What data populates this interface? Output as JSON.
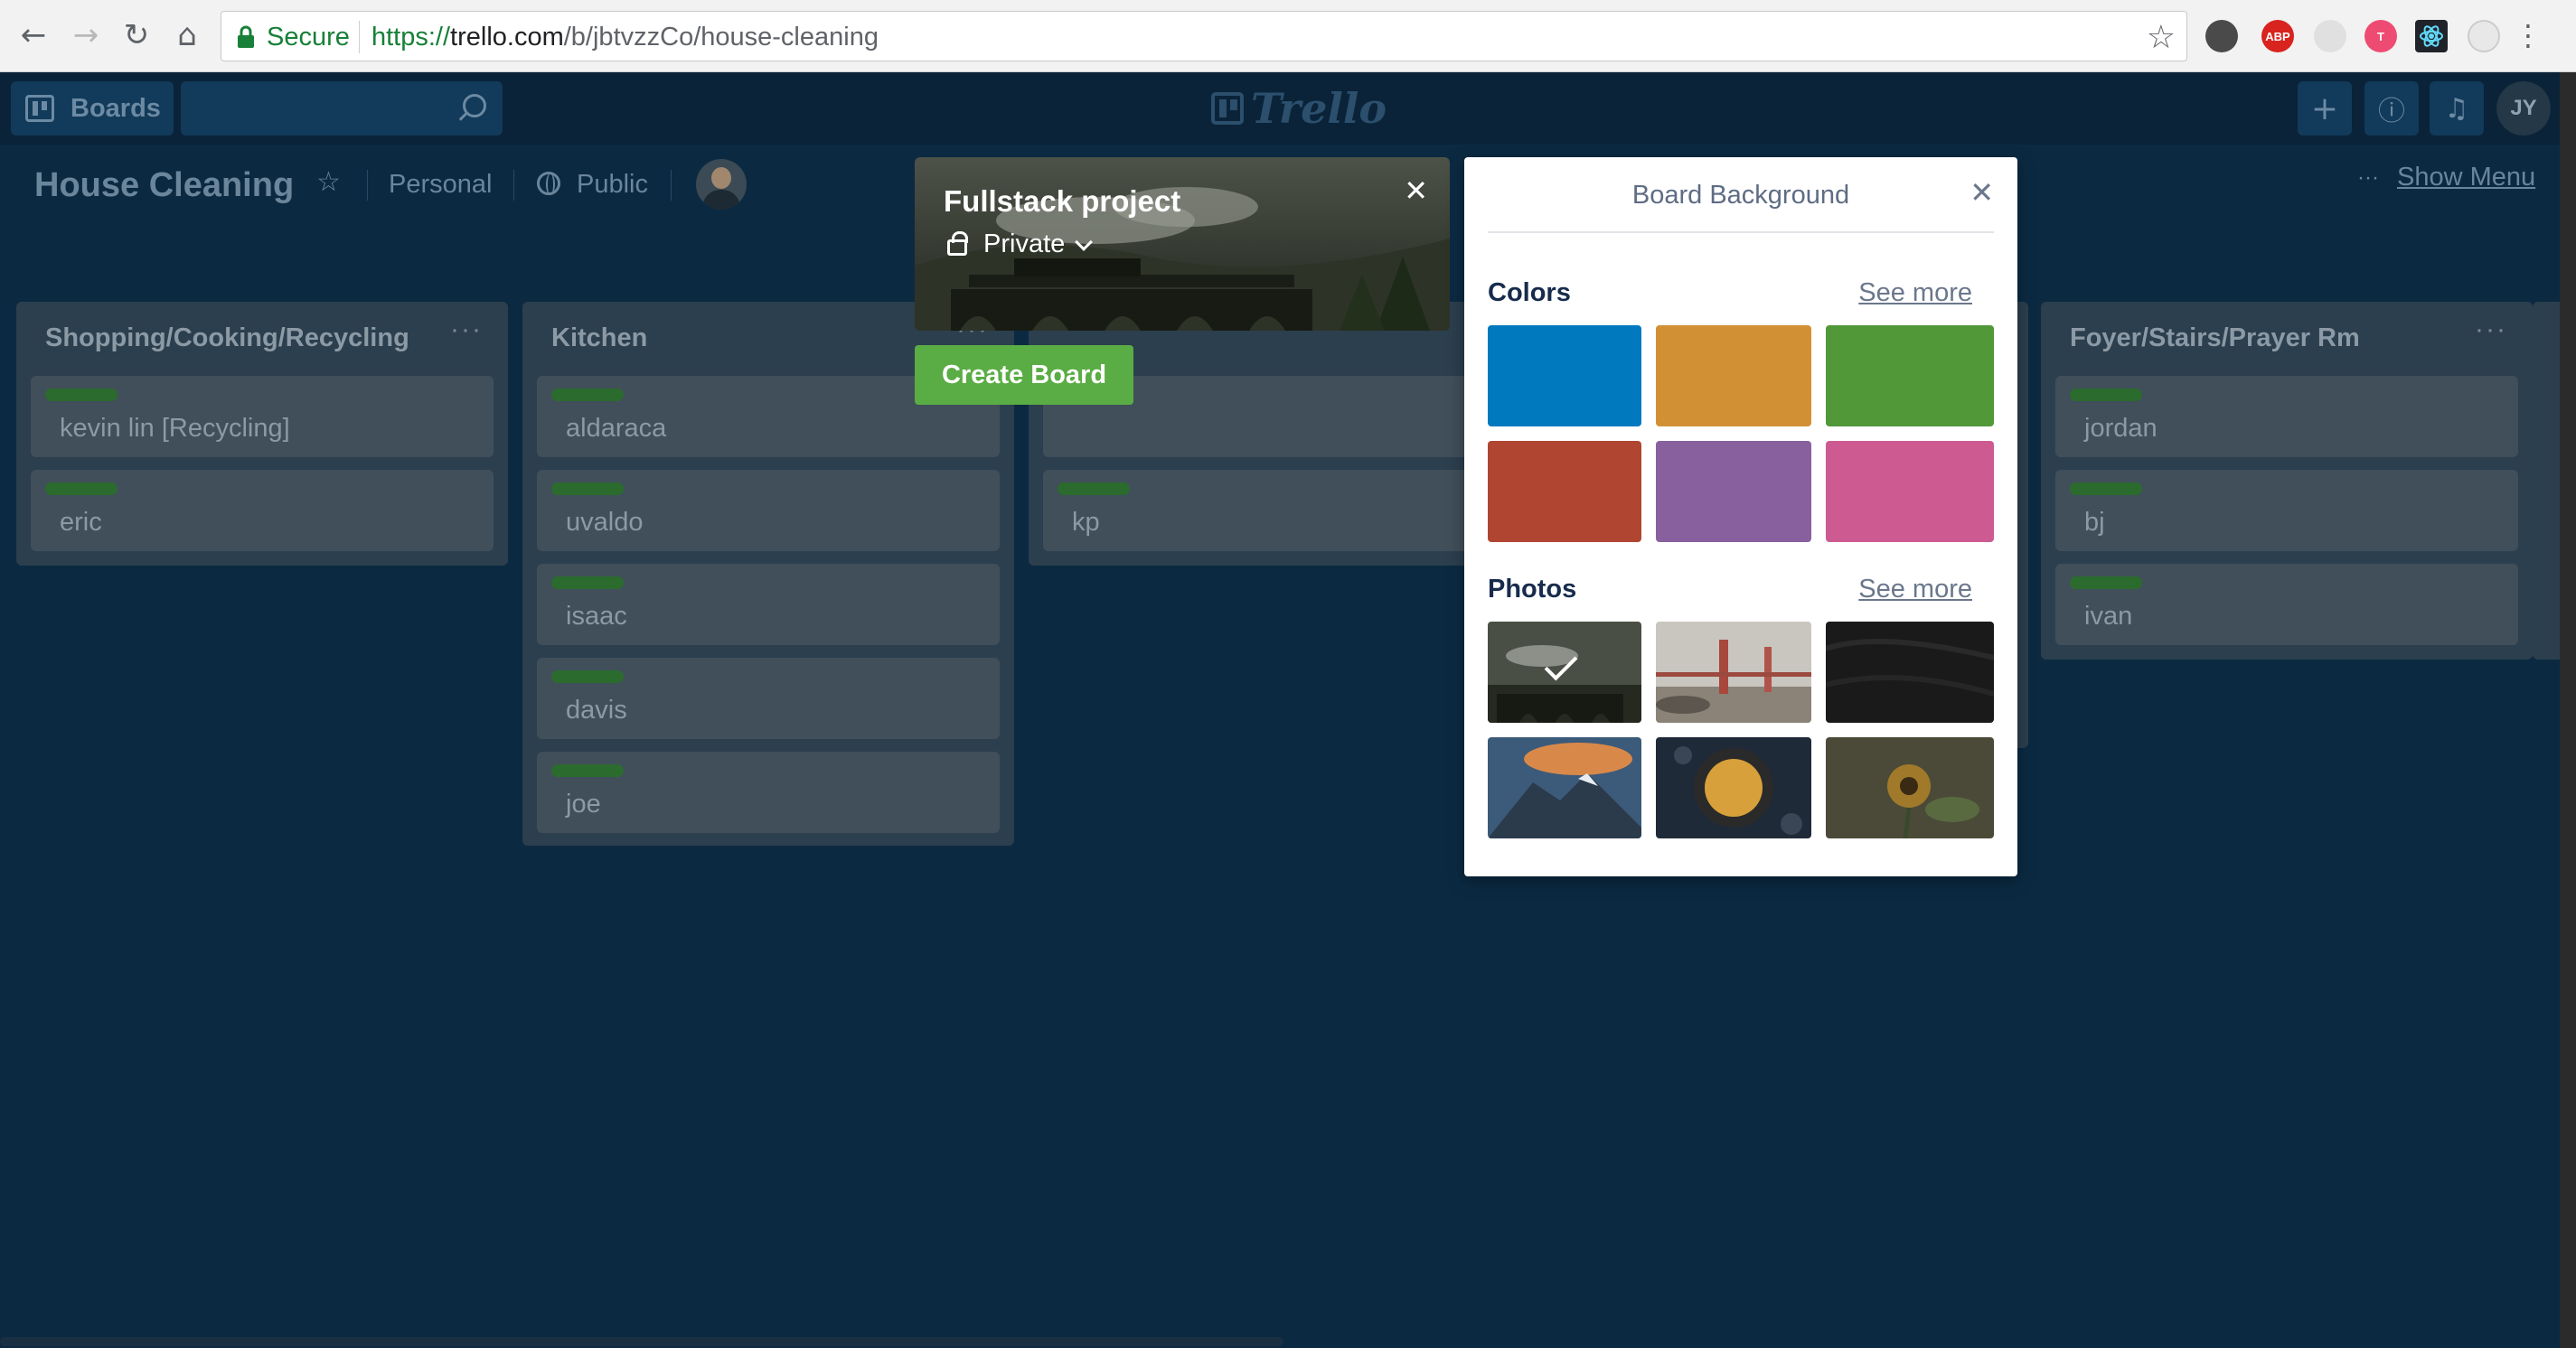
{
  "browser": {
    "secure_label": "Secure",
    "url_scheme": "https://",
    "url_host": "trello.com",
    "url_path": "/b/jbtvzzCo/house-cleaning",
    "extensions": [
      "evernote-icon",
      "adblock-icon",
      "ghost-icon",
      "t-icon",
      "react-devtools-icon",
      "circle-icon"
    ],
    "adblock_label": "ABP",
    "t_label": "T"
  },
  "header": {
    "boards_label": "Boards",
    "search_placeholder": "",
    "logo_text": "Trello",
    "user_initials": "JY"
  },
  "board": {
    "title": "House Cleaning",
    "team": "Personal",
    "visibility": "Public",
    "show_menu": "Show Menu",
    "dots": "···"
  },
  "lists": [
    {
      "title": "Shopping/Cooking/Recycling",
      "cards": [
        "kevin lin [Recycling]",
        "eric"
      ]
    },
    {
      "title": "Kitchen",
      "cards": [
        "aldaraca",
        "uvaldo",
        "isaac",
        "davis",
        "joe"
      ]
    },
    {
      "title": "",
      "cards": [
        "",
        "kp"
      ]
    },
    {
      "title": "Foyer/Stairs/Prayer Rm",
      "cards": [
        "jordan",
        "bj",
        "ivan"
      ]
    }
  ],
  "list_menu_label": "···",
  "create_board": {
    "title": "Fullstack project",
    "privacy": "Private",
    "button": "Create Board"
  },
  "background_popover": {
    "title": "Board Background",
    "colors_heading": "Colors",
    "photos_heading": "Photos",
    "see_more": "See more",
    "colors": [
      "#0079bf",
      "#d29034",
      "#519839",
      "#b04632",
      "#89609e",
      "#cd5a91"
    ],
    "photos": [
      "steam-train",
      "golden-gate-bridge",
      "dark-sand",
      "mountain-peak",
      "pie-dish",
      "sunflower"
    ],
    "selected_photo": 0
  }
}
